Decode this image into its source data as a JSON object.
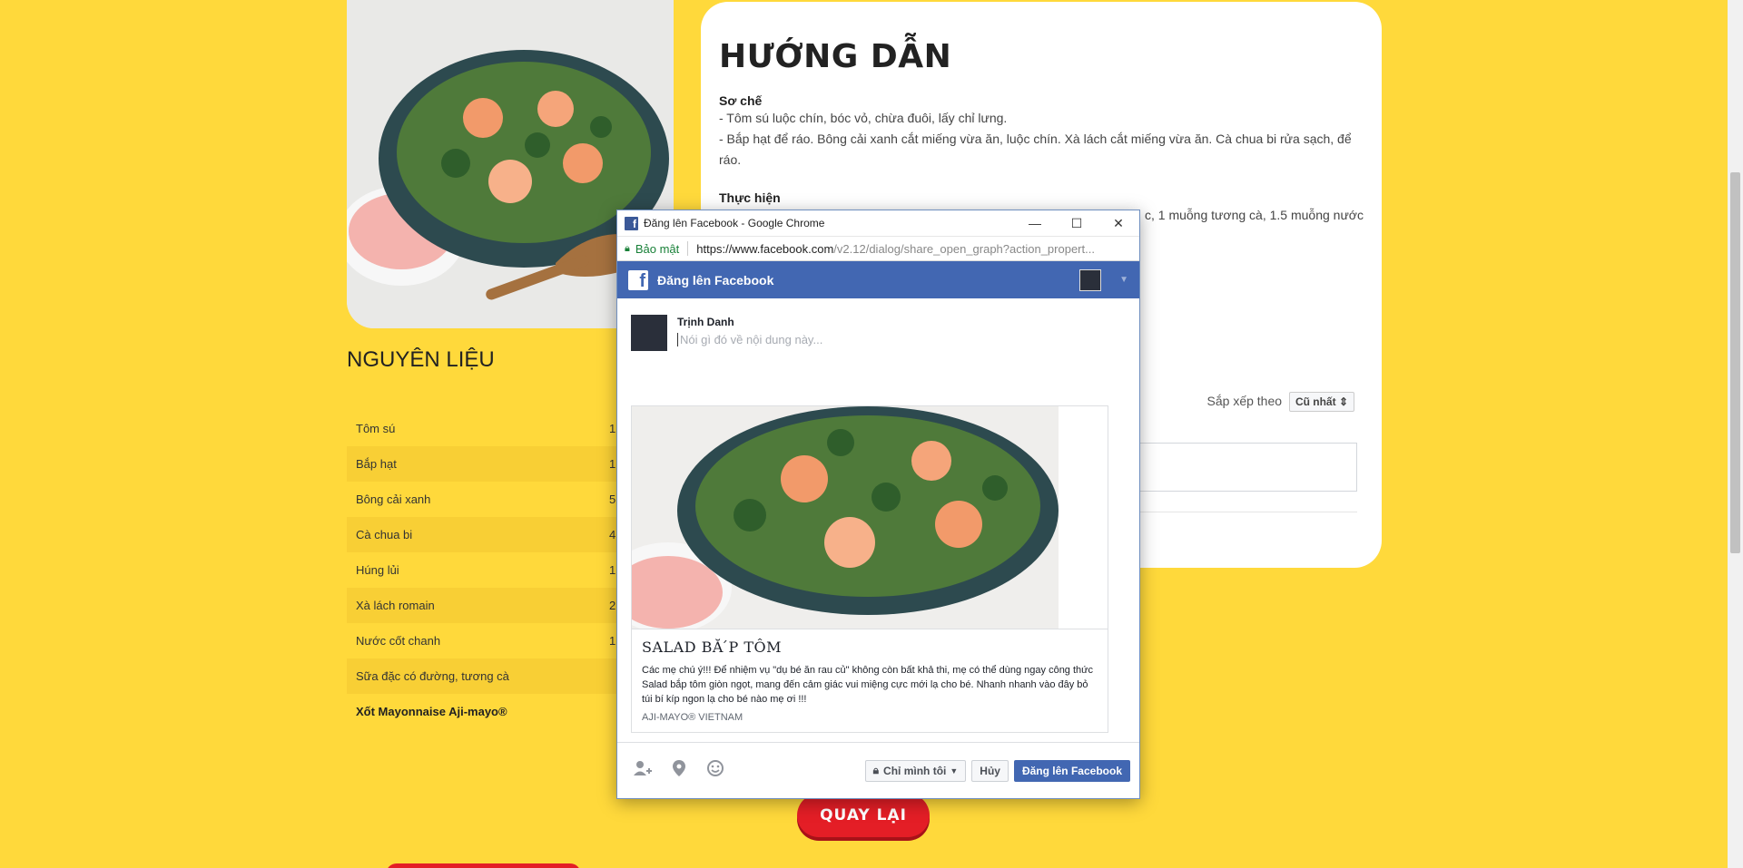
{
  "guide": {
    "title": "HƯỚNG DẪN",
    "section1_title": "Sơ chế",
    "section1_lines": [
      "- Tôm sú luộc chín, bóc vỏ, chừa đuôi, lấy chỉ lưng.",
      "- Bắp hạt để ráo. Bông cải xanh cắt miếng vừa ăn, luộc chín. Xà lách cắt miếng vừa ăn. Cà chua bi rửa sạch, để",
      "ráo."
    ],
    "section2_title": "Thực hiện",
    "section2_partial": "c, 1 muỗng tương cà, 1.5 muỗng nước",
    "sort_label": "Sắp xếp theo",
    "sort_value": "Cũ nhất"
  },
  "ingredients": {
    "title": "NGUYÊN LIỆU",
    "rows": [
      {
        "name": "Tôm sú",
        "qty": "1"
      },
      {
        "name": "Bắp hạt",
        "qty": "1"
      },
      {
        "name": "Bông cải xanh",
        "qty": "5"
      },
      {
        "name": "Cà chua bi",
        "qty": "4"
      },
      {
        "name": "Húng lủi",
        "qty": "1"
      },
      {
        "name": "Xà lách romain",
        "qty": "2"
      },
      {
        "name": "Nước cốt chanh",
        "qty": "1"
      },
      {
        "name": "Sữa đặc có đường, tương cà",
        "qty": ""
      },
      {
        "name": "Xốt Mayonnaise Aji-mayo®",
        "qty": ""
      }
    ]
  },
  "back_button": "QUAY LẠI",
  "popup": {
    "window_title": "Đăng lên Facebook - Google Chrome",
    "secure_label": "Bảo mật",
    "url_host": "https://www.facebook.com",
    "url_path": "/v2.12/dialog/share_open_graph?action_propert...",
    "fb_title": "Đăng lên Facebook",
    "user_name": "Trịnh Danh",
    "placeholder": "Nói gì đó về nội dung này...",
    "preview_title": "SALAD BĂ ́P TÔM",
    "preview_desc": "Các mẹ chú ý!!! Để nhiệm vụ \"dụ bé ăn rau củ\" không còn bất khả thi, mẹ có thể dùng ngay công thức Salad bắp tôm giòn ngọt, mang đến cảm giác vui miệng cực mới lạ cho bé. Nhanh nhanh vào đây bỏ túi bí kíp ngon lạ cho bé nào mẹ ơi !!!",
    "preview_source": "AJI-MAYO® VIETNAM",
    "privacy_label": "Chỉ mình tôi",
    "cancel_label": "Hủy",
    "post_label": "Đăng lên Facebook"
  },
  "icons": {
    "tag_friend": "person-plus-icon",
    "location": "map-pin-icon",
    "feeling": "smiley-icon",
    "lock": "lock-icon"
  },
  "colors": {
    "page_bg": "#ffd93b",
    "facebook_blue": "#4267b2",
    "back_button_red": "#e41e26"
  }
}
